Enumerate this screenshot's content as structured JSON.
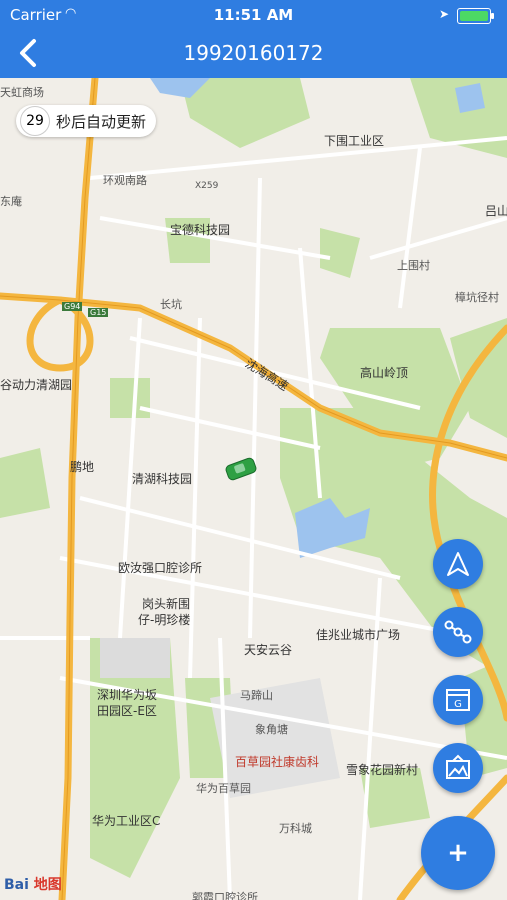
{
  "status": {
    "carrier": "Carrier",
    "time": "11:51 AM"
  },
  "nav": {
    "title": "19920160172",
    "back_icon": "chevron-left-icon"
  },
  "countdown": {
    "seconds": "29",
    "text": "秒后自动更新"
  },
  "map_labels": {
    "tianhong": "天虹商场",
    "xiaweigongye": "下围工业区",
    "huanguannanlu": "环观南路",
    "x259": "X259",
    "baodekeji": "宝德科技园",
    "luvshan": "吕山",
    "shangwei": "上围村",
    "zhangkengjing": "樟坑径村",
    "changkeng": "长坑",
    "g94": "G94",
    "g15": "G15",
    "yanhai": "沈海高速",
    "gaoshan": "高山岭顶",
    "gudongli": "谷动力清湖园",
    "pengdi": "鹏地",
    "qinghukeji": "清湖科技园",
    "ouru": "欧汝强口腔诊所",
    "gangtou": "岗头新围",
    "gangtou2": "仔-明珍楼",
    "jiazhao": "佳兆业城市广场",
    "tianan": "天安云谷",
    "huaweiban": "深圳华为坂",
    "huaweiban2": "田园区-E区",
    "matishan": "马蹄山",
    "xiangjiao": "象角塘",
    "baicaoyuan": "百草园社康齿科",
    "xuexiang": "雪象花园新村",
    "huaweibaicao": "华为百草园",
    "huaweigongye": "华为工业区C",
    "wanke": "万科城",
    "bottom": "郭霞口腔诊所",
    "donghe": "东庵"
  },
  "fabs": [
    {
      "name": "navigate-button",
      "icon": "navigation-arrow-icon"
    },
    {
      "name": "track-button",
      "icon": "route-icon"
    },
    {
      "name": "fence-button",
      "icon": "geofence-icon"
    },
    {
      "name": "map-layer-button",
      "icon": "picture-icon"
    }
  ],
  "add_button": {
    "label": "+"
  },
  "logo": {
    "text": "Bai",
    "text2": "地图"
  },
  "colors": {
    "accent": "#2f7de1",
    "highway": "#f4b63f",
    "park": "#c6e1a8"
  }
}
